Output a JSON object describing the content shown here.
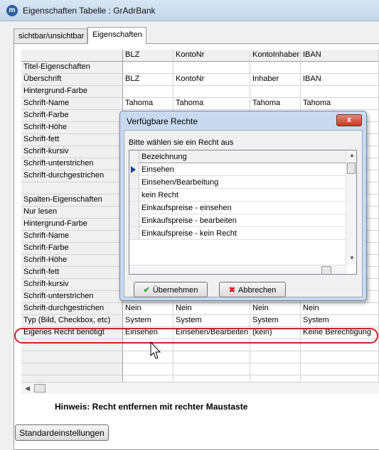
{
  "window": {
    "title": "Eigenschaften Tabelle : GrAdrBank",
    "icon_letter": "m"
  },
  "tabs": [
    {
      "label": "sichtbar/unsichtbar"
    },
    {
      "label": "Eigenschaften"
    }
  ],
  "grid": {
    "columns": [
      "",
      "BLZ",
      "KontoNr",
      "KontoInhaber",
      "IBAN"
    ],
    "rows": [
      [
        "Titel-Eigenschaften",
        "",
        "",
        "",
        ""
      ],
      [
        "Überschrift",
        "BLZ",
        "KontoNr",
        "Inhaber",
        "IBAN"
      ],
      [
        "Hintergrund-Farbe",
        "",
        "",
        "",
        ""
      ],
      [
        "Schrift-Name",
        "Tahoma",
        "Tahoma",
        "Tahoma",
        "Tahoma"
      ],
      [
        "Schrift-Farbe",
        "",
        "",
        "",
        ""
      ],
      [
        "Schrift-Höhe",
        "",
        "",
        "",
        ""
      ],
      [
        "Schrift-fett",
        "",
        "",
        "",
        ""
      ],
      [
        "Schrift-kursiv",
        "",
        "",
        "",
        ""
      ],
      [
        "Schrift-unterstrichen",
        "",
        "",
        "",
        ""
      ],
      [
        "Schrift-durchgestrichen",
        "",
        "",
        "",
        ""
      ],
      [
        "",
        "",
        "",
        "",
        ""
      ],
      [
        "Spalten-Eigenschaften",
        "",
        "",
        "",
        ""
      ],
      [
        "Nur lesen",
        "",
        "",
        "",
        ""
      ],
      [
        "Hintergrund-Farbe",
        "",
        "",
        "",
        ""
      ],
      [
        "Schrift-Name",
        "",
        "",
        "",
        ""
      ],
      [
        "Schrift-Farbe",
        "",
        "",
        "",
        ""
      ],
      [
        "Schrift-Höhe",
        "",
        "",
        "",
        ""
      ],
      [
        "Schrift-fett",
        "",
        "",
        "",
        ""
      ],
      [
        "Schrift-kursiv",
        "",
        "",
        "",
        ""
      ],
      [
        "Schrift-unterstrichen",
        "",
        "",
        "",
        ""
      ],
      [
        "Schrift-durchgestrichen",
        "Nein",
        "Nein",
        "Nein",
        "Nein"
      ],
      [
        "Typ (Bild, Checkbox, etc)",
        "System",
        "System",
        "System",
        "System"
      ],
      [
        "Eigenes Recht benötigt",
        "Einsehen",
        "Einsehen/Bearbeiten",
        "(kein)",
        "Keine Berechtigung"
      ],
      [
        "",
        "",
        "",
        "",
        ""
      ],
      [
        "",
        "",
        "",
        "",
        ""
      ],
      [
        "",
        "",
        "",
        "",
        ""
      ],
      [
        "",
        "",
        "",
        "",
        ""
      ]
    ]
  },
  "hint": "Hinweis: Recht entfernen mit rechter Maustaste",
  "buttons": {
    "standard": "Standardeinstellungen"
  },
  "dialog": {
    "title": "Verfügbare Rechte",
    "close_label": "x",
    "prompt": "Bitte wählen sie ein Recht aus",
    "column_header": "Bezeichnung",
    "items": [
      "Einsehen",
      "Einsehen/Bearbeitung",
      "kein Recht",
      "Einkaufspreise - einsehen",
      "Einkaufspreise - bearbeiten",
      "Einkaufspreise - kein Recht"
    ],
    "selected_index": 0,
    "ok_label": "Übernehmen",
    "cancel_label": "Abbrechen"
  },
  "icons": {
    "ok": "check-icon",
    "cancel": "x-icon",
    "cursor": "mouse-pointer-icon"
  },
  "colors": {
    "highlight": "#c0282b",
    "title_gradient": "#c2d5ea",
    "selected_marker": "#1a3f9e"
  }
}
